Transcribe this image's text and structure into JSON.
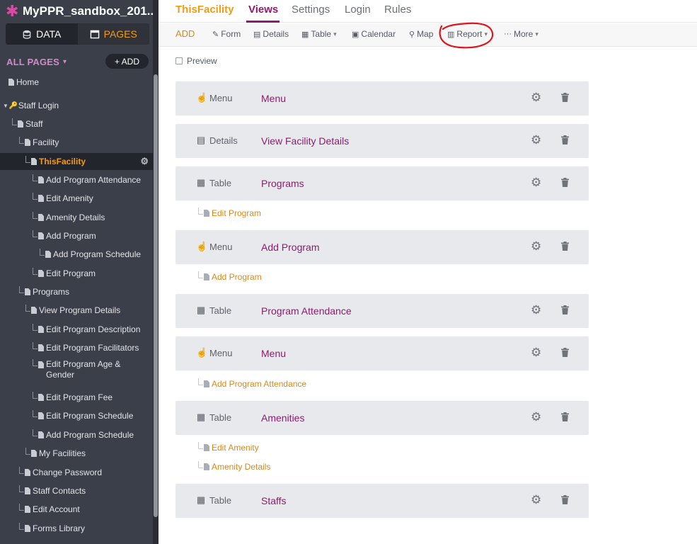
{
  "app": {
    "title": "MyPPR_sandbox_201...",
    "logo_color": "#d94aa6"
  },
  "mode_switch": {
    "data_label": "DATA",
    "pages_label": "PAGES",
    "active": "PAGES"
  },
  "sidebar": {
    "section_label": "ALL PAGES",
    "add_button": "+ ADD",
    "tree": [
      {
        "label": "Home",
        "icon": "page-icon"
      },
      {
        "label": "Staff Login",
        "icon": "key-icon"
      },
      {
        "label": "Staff",
        "icon": "page-icon"
      },
      {
        "label": "Facility",
        "icon": "page-icon"
      },
      {
        "label": "ThisFacility",
        "icon": "page-icon",
        "active": true
      },
      {
        "label": "Add Program Attendance",
        "icon": "page-icon"
      },
      {
        "label": "Edit Amenity",
        "icon": "page-icon"
      },
      {
        "label": "Amenity Details",
        "icon": "page-icon"
      },
      {
        "label": "Add Program",
        "icon": "page-icon"
      },
      {
        "label": "Add Program Schedule",
        "icon": "page-icon"
      },
      {
        "label": "Edit Program",
        "icon": "page-icon"
      },
      {
        "label": "Programs",
        "icon": "page-icon"
      },
      {
        "label": "View Program Details",
        "icon": "page-icon"
      },
      {
        "label": "Edit Program Description",
        "icon": "page-icon"
      },
      {
        "label": "Edit Program Facilitators",
        "icon": "page-icon"
      },
      {
        "label": "Edit Program Age & Gender",
        "icon": "page-icon"
      },
      {
        "label": "Edit Program Fee",
        "icon": "page-icon"
      },
      {
        "label": "Edit Program Schedule",
        "icon": "page-icon"
      },
      {
        "label": "Add Program Schedule",
        "icon": "page-icon"
      },
      {
        "label": "My Facilities",
        "icon": "page-icon"
      },
      {
        "label": "Change Password",
        "icon": "page-icon"
      },
      {
        "label": "Staff Contacts",
        "icon": "page-icon"
      },
      {
        "label": "Edit Account",
        "icon": "page-icon"
      },
      {
        "label": "Forms Library",
        "icon": "page-icon"
      }
    ]
  },
  "top_nav": {
    "page_name": "ThisFacility",
    "tabs": [
      "Views",
      "Settings",
      "Login",
      "Rules"
    ],
    "active_tab": "Views"
  },
  "toolbar": {
    "add_label": "ADD",
    "items": [
      "Form",
      "Details",
      "Table",
      "Calendar",
      "Map",
      "Report",
      "More"
    ],
    "highlighted": "Report",
    "highlight_color": "#e0141b"
  },
  "preview_label": "Preview",
  "views": [
    {
      "type": "Menu",
      "icon": "hand-pointer-icon",
      "title": "Menu",
      "children": []
    },
    {
      "type": "Details",
      "icon": "details-icon",
      "title": "View Facility Details",
      "children": []
    },
    {
      "type": "Table",
      "icon": "table-icon",
      "title": "Programs",
      "children": [
        "Edit Program"
      ]
    },
    {
      "type": "Menu",
      "icon": "hand-pointer-icon",
      "title": "Add Program",
      "children": [
        "Add Program"
      ]
    },
    {
      "type": "Table",
      "icon": "table-icon",
      "title": "Program Attendance",
      "children": []
    },
    {
      "type": "Menu",
      "icon": "hand-pointer-icon",
      "title": "Menu",
      "children": [
        "Add Program Attendance"
      ]
    },
    {
      "type": "Table",
      "icon": "table-icon",
      "title": "Amenities",
      "children": [
        "Edit Amenity",
        "Amenity Details"
      ]
    },
    {
      "type": "Table",
      "icon": "table-icon",
      "title": "Staffs",
      "children": []
    }
  ],
  "colors": {
    "accent_purple": "#8e1b6e",
    "accent_orange": "#f39c12",
    "sidebar_bg": "#3b3f49"
  }
}
